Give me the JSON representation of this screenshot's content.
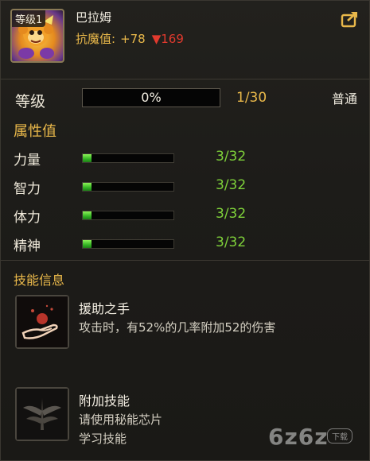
{
  "hero": {
    "level_tag": "等级1",
    "name": "巴拉姆",
    "resist_label": "抗魔值:",
    "resist_plus": "+78",
    "resist_minus": "▼169",
    "avatar_icon": "monkey-hero-portrait-icon",
    "share_icon": "share-external-icon"
  },
  "level": {
    "label": "等级",
    "percent_text": "0%",
    "progress": 0,
    "count": "1/30",
    "quality": "普通"
  },
  "attributes": {
    "title": "属性值",
    "items": [
      {
        "label": "力量",
        "value": "3/32",
        "progress": 0.09375
      },
      {
        "label": "智力",
        "value": "3/32",
        "progress": 0.09375
      },
      {
        "label": "体力",
        "value": "3/32",
        "progress": 0.09375
      },
      {
        "label": "精神",
        "value": "3/32",
        "progress": 0.09375
      }
    ]
  },
  "skills": {
    "title": "技能信息",
    "items": [
      {
        "name": "援助之手",
        "desc": [
          "攻击时，有52%的几率附加52的伤害"
        ],
        "icon": "helping-hand-icon"
      },
      {
        "name": "附加技能",
        "desc": [
          "请使用秘能芯片",
          "学习技能"
        ],
        "icon": "locked-wing-skill-icon"
      }
    ]
  },
  "watermark": {
    "text": "6z6z",
    "tag": "下载"
  },
  "colors": {
    "accent_gold": "#e9b84a",
    "decrease_red": "#e23a2e",
    "stat_green": "#7fd23a"
  }
}
